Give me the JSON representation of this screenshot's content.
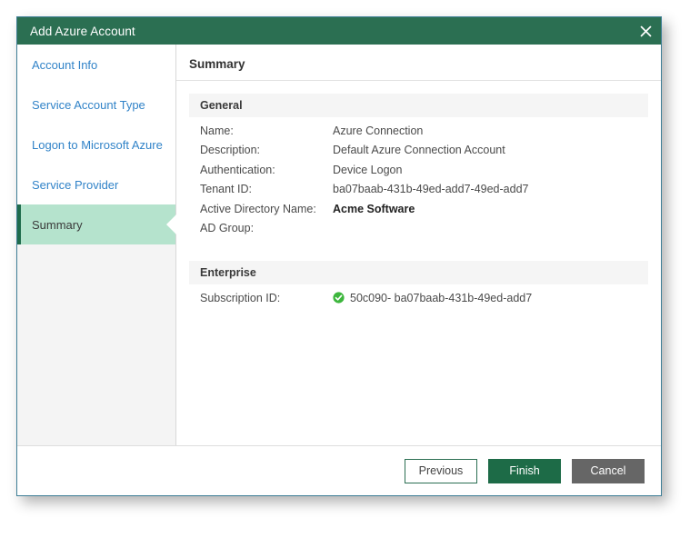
{
  "window": {
    "title": "Add Azure Account",
    "close_icon": "close-icon"
  },
  "sidebar": {
    "items": [
      {
        "label": "Account Info",
        "selected": false
      },
      {
        "label": "Service Account Type",
        "selected": false
      },
      {
        "label": "Logon to Microsoft Azure",
        "selected": false
      },
      {
        "label": "Service Provider",
        "selected": false
      },
      {
        "label": "Summary",
        "selected": true
      }
    ]
  },
  "content": {
    "header": "Summary",
    "sections": [
      {
        "title": "General",
        "fields": [
          {
            "label": "Name:",
            "value": "Azure Connection"
          },
          {
            "label": "Description:",
            "value": "Default Azure Connection Account"
          },
          {
            "label": "Authentication:",
            "value": "Device Logon"
          },
          {
            "label": "Tenant ID:",
            "value": "ba07baab-431b-49ed-add7-49ed-add7"
          },
          {
            "label": "Active Directory Name:",
            "value": "Acme Software"
          },
          {
            "label": "AD Group:",
            "value": ""
          }
        ]
      },
      {
        "title": "Enterprise",
        "fields": [
          {
            "label": "Subscription ID:",
            "value": "50c090- ba07baab-431b-49ed-add7",
            "icon": "success-check-icon"
          }
        ]
      }
    ]
  },
  "footer": {
    "previous_label": "Previous",
    "finish_label": "Finish",
    "cancel_label": "Cancel"
  },
  "colors": {
    "title_bar_green": "#2b6f52",
    "selected_item_green": "#b5e3cd",
    "selected_bar_green": "#1f6b4c",
    "link_blue": "#3183c8",
    "finish_green": "#1d6b47",
    "cancel_gray": "#666666",
    "check_green": "#3db63d",
    "dialog_border": "#3e7e96",
    "section_band": "#f5f5f5"
  }
}
